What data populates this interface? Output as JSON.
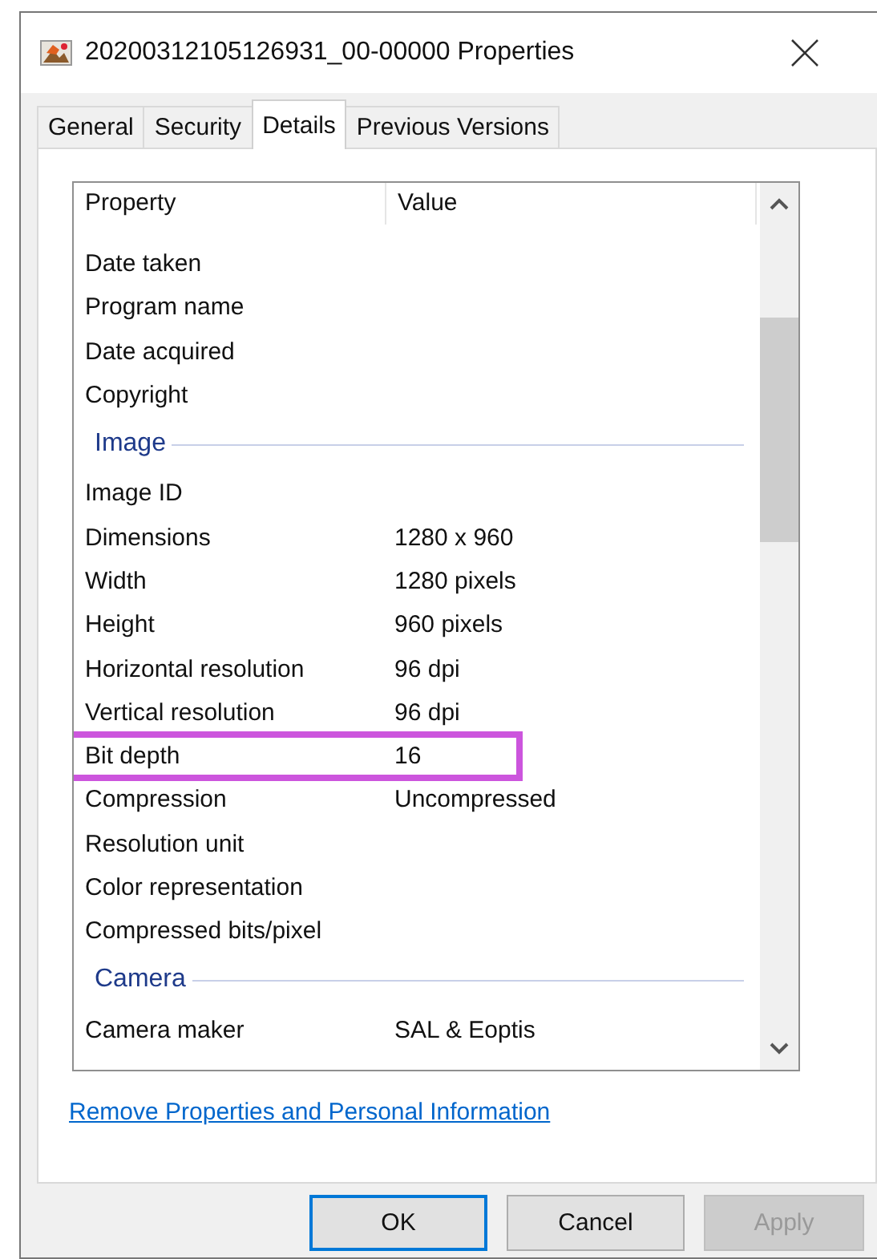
{
  "window": {
    "title": "20200312105126931_00-00000 Properties"
  },
  "tabs": [
    {
      "label": "General",
      "selected": false
    },
    {
      "label": "Security",
      "selected": false
    },
    {
      "label": "Details",
      "selected": true
    },
    {
      "label": "Previous Versions",
      "selected": false
    }
  ],
  "table": {
    "columns": [
      "Property",
      "Value"
    ],
    "rows": [
      {
        "kind": "row",
        "property": "Date taken",
        "value": "",
        "highlighted": false
      },
      {
        "kind": "row",
        "property": "Program name",
        "value": "",
        "highlighted": false
      },
      {
        "kind": "row",
        "property": "Date acquired",
        "value": "",
        "highlighted": false
      },
      {
        "kind": "row",
        "property": "Copyright",
        "value": "",
        "highlighted": false
      },
      {
        "kind": "group",
        "label": "Image"
      },
      {
        "kind": "row",
        "property": "Image ID",
        "value": "",
        "highlighted": false
      },
      {
        "kind": "row",
        "property": "Dimensions",
        "value": "1280 x 960",
        "highlighted": false
      },
      {
        "kind": "row",
        "property": "Width",
        "value": "1280 pixels",
        "highlighted": false
      },
      {
        "kind": "row",
        "property": "Height",
        "value": "960 pixels",
        "highlighted": false
      },
      {
        "kind": "row",
        "property": "Horizontal resolution",
        "value": "96 dpi",
        "highlighted": false
      },
      {
        "kind": "row",
        "property": "Vertical resolution",
        "value": "96 dpi",
        "highlighted": false
      },
      {
        "kind": "row",
        "property": "Bit depth",
        "value": "16",
        "highlighted": true
      },
      {
        "kind": "row",
        "property": "Compression",
        "value": "Uncompressed",
        "highlighted": false
      },
      {
        "kind": "row",
        "property": "Resolution unit",
        "value": "",
        "highlighted": false
      },
      {
        "kind": "row",
        "property": "Color representation",
        "value": "",
        "highlighted": false
      },
      {
        "kind": "row",
        "property": "Compressed bits/pixel",
        "value": "",
        "highlighted": false
      },
      {
        "kind": "group",
        "label": "Camera"
      },
      {
        "kind": "row",
        "property": "Camera maker",
        "value": "SAL & Eoptis",
        "highlighted": false
      }
    ]
  },
  "link": "Remove Properties and Personal Information",
  "buttons": [
    {
      "label": "OK",
      "default": true,
      "disabled": false
    },
    {
      "label": "Cancel",
      "default": false,
      "disabled": false
    },
    {
      "label": "Apply",
      "default": false,
      "disabled": true
    }
  ]
}
